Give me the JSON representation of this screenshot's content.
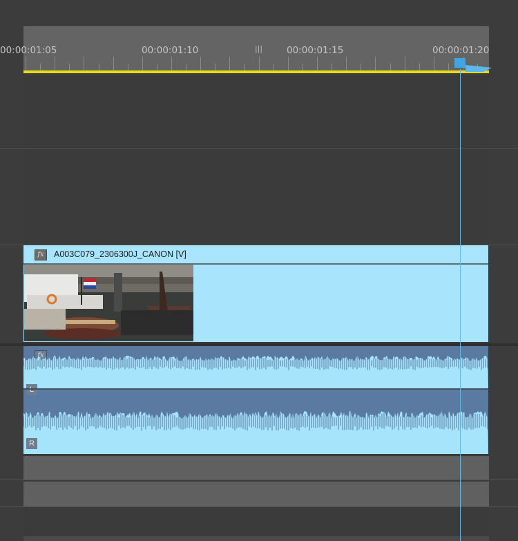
{
  "timeline": {
    "ruler": {
      "timecodes": [
        "00:00:01:05",
        "00:00:01:10",
        "00:00:01:15",
        "00:00:01:20"
      ],
      "grip_glyph": "|||"
    },
    "playhead_timecode": "00:00:01:20"
  },
  "video_track": {
    "clip": {
      "name": "A003C079_2306300J_CANON [V]",
      "fx_label": "fx"
    }
  },
  "audio_track": {
    "clip": {
      "fx_label": "fx",
      "channels": [
        {
          "label": "L"
        },
        {
          "label": "R"
        }
      ]
    }
  },
  "colors": {
    "work_area_bar": "#e7de19",
    "video_clip": "#a8e4fb",
    "audio_clip": "#5a7aa1",
    "playhead": "#3fa6e0"
  }
}
